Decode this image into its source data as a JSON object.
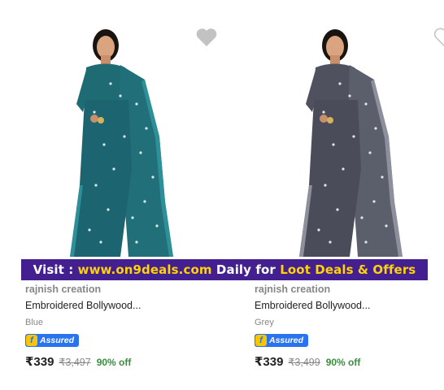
{
  "banner": {
    "prefix": "Visit : ",
    "site": "www.on9deals.com",
    "middle": " Daily for ",
    "highlight": "Loot Deals & Offers"
  },
  "products": [
    {
      "brand": "rajnish creation",
      "title": "Embroidered Bollywood...",
      "variant": "Blue",
      "assured_label": "Assured",
      "price": "₹339",
      "mrp": "₹3,497",
      "discount": "90% off",
      "saree_color": "#1f6b73",
      "wishlist_icon": "heart-icon"
    },
    {
      "brand": "rajnish creation",
      "title": "Embroidered Bollywood...",
      "variant": "Grey",
      "assured_label": "Assured",
      "price": "₹339",
      "mrp": "₹3,499",
      "discount": "90% off",
      "saree_color": "#5b5e6b",
      "wishlist_icon": "heart-icon"
    }
  ],
  "colors": {
    "banner_bg": "#431f8f",
    "banner_highlight": "#ffd400",
    "discount": "#388e3c",
    "assured": "#2874f0"
  }
}
